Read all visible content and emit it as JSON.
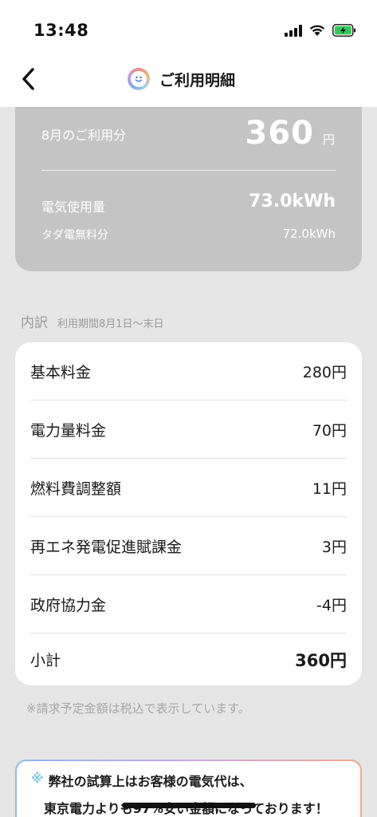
{
  "status_bar": {
    "time": "13:48"
  },
  "nav": {
    "title": "ご利用明細"
  },
  "summary": {
    "month_label": "8月のご利用分",
    "amount": "360",
    "unit": "円",
    "usage_label": "電気使用量",
    "usage_value": "73.0kWh",
    "free_label": "タダ電無料分",
    "free_value": "72.0kWh"
  },
  "breakdown": {
    "title": "内訳",
    "period": "利用期間8月1日～末日",
    "rows": [
      {
        "label": "基本料金",
        "value": "280円"
      },
      {
        "label": "電力量料金",
        "value": "70円"
      },
      {
        "label": "燃料費調整額",
        "value": "11円"
      },
      {
        "label": "再エネ発電促進賦課金",
        "value": "3円"
      },
      {
        "label": "政府協力金",
        "value": "-4円"
      }
    ],
    "total": {
      "label": "小計",
      "value": "360円"
    }
  },
  "tax_note": "※請求予定金額は税込で表示しています。",
  "promo": {
    "mark": "※",
    "line1": "弊社の試算上はお客様の電気代は、",
    "line2": "東京電力よりも97%安い金額になっております！"
  },
  "colors": {
    "summary_bg": "#c4c4c4",
    "page_bg": "#e6e6e6",
    "card_bg": "#ffffff",
    "accent_mark": "#7ec8e3"
  }
}
